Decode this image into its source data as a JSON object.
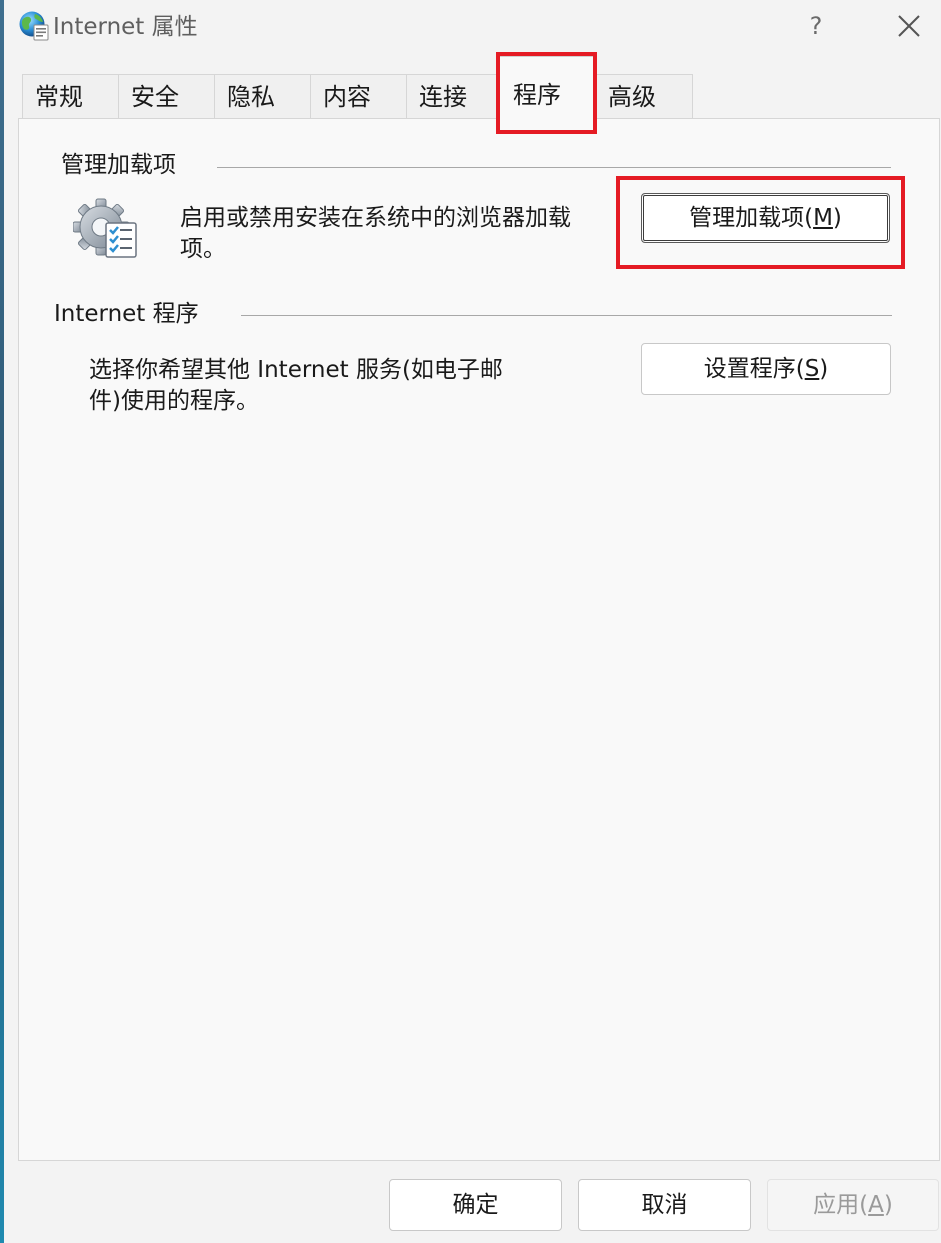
{
  "window": {
    "title": "Internet 属性",
    "help_label": "?",
    "icon": "ie-globe-icon",
    "close_icon": "close-icon"
  },
  "tabs": [
    {
      "label": "常规",
      "active": false
    },
    {
      "label": "安全",
      "active": false
    },
    {
      "label": "隐私",
      "active": false
    },
    {
      "label": "内容",
      "active": false
    },
    {
      "label": "连接",
      "active": false
    },
    {
      "label": "程序",
      "active": true
    },
    {
      "label": "高级",
      "active": false
    }
  ],
  "addons": {
    "title": "管理加载项",
    "description_line1": "启用或禁用安装在系统中的浏览器加载",
    "description_line2": "项。",
    "button_prefix": "管理加载项(",
    "button_mnemonic": "M",
    "button_suffix": ")",
    "icon": "gear-checklist-icon"
  },
  "programs": {
    "title": "Internet 程序",
    "description_line1": "选择你希望其他 Internet 服务(如电子邮",
    "description_line2": "件)使用的程序。",
    "button_prefix": "设置程序(",
    "button_mnemonic": "S",
    "button_suffix": ")"
  },
  "footer": {
    "ok_label": "确定",
    "cancel_label": "取消",
    "apply_prefix": "应用(",
    "apply_mnemonic": "A",
    "apply_suffix": ")"
  },
  "colors": {
    "highlight": "#e51b24",
    "panel_bg": "#f9f9f9",
    "window_bg": "#f3f3f3"
  }
}
